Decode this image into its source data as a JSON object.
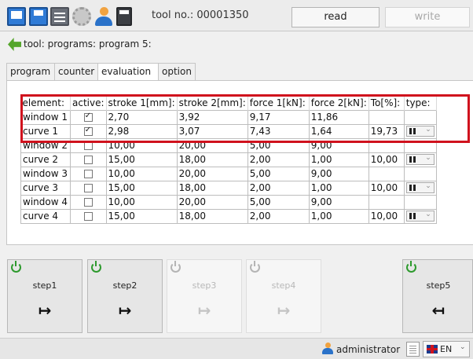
{
  "toolbar": {
    "icons": [
      "monitor-icon",
      "save-icon",
      "drawer-icon",
      "gear-icon",
      "user-icon",
      "calculator-icon"
    ],
    "tool_no": "tool no.: 00001350",
    "read_label": "read",
    "write_label": "write"
  },
  "breadcrumb": {
    "text": "tool: programs: program 5:"
  },
  "tabs": [
    {
      "label": "program"
    },
    {
      "label": "counter"
    },
    {
      "label": "evaluation",
      "active": true
    },
    {
      "label": "option"
    }
  ],
  "table": {
    "headers": [
      "element:",
      "active:",
      "stroke 1[mm]:",
      "stroke 2[mm]:",
      "force 1[kN]:",
      "force 2[kN]:",
      "To[%]:",
      "type:"
    ],
    "rows": [
      {
        "element": "window 1",
        "active": true,
        "s1": "2,70",
        "s2": "3,92",
        "f1": "9,17",
        "f2": "11,86",
        "to": "",
        "type": false
      },
      {
        "element": "curve 1",
        "active": true,
        "s1": "2,98",
        "s2": "3,07",
        "f1": "7,43",
        "f2": "1,64",
        "to": "19,73",
        "type": true
      },
      {
        "element": "window 2",
        "active": false,
        "s1": "10,00",
        "s2": "20,00",
        "f1": "5,00",
        "f2": "9,00",
        "to": "",
        "type": false
      },
      {
        "element": "curve 2",
        "active": false,
        "s1": "15,00",
        "s2": "18,00",
        "f1": "2,00",
        "f2": "1,00",
        "to": "10,00",
        "type": true
      },
      {
        "element": "window 3",
        "active": false,
        "s1": "10,00",
        "s2": "20,00",
        "f1": "5,00",
        "f2": "9,00",
        "to": "",
        "type": false
      },
      {
        "element": "curve 3",
        "active": false,
        "s1": "15,00",
        "s2": "18,00",
        "f1": "2,00",
        "f2": "1,00",
        "to": "10,00",
        "type": true
      },
      {
        "element": "window 4",
        "active": false,
        "s1": "10,00",
        "s2": "20,00",
        "f1": "5,00",
        "f2": "9,00",
        "to": "",
        "type": false
      },
      {
        "element": "curve 4",
        "active": false,
        "s1": "15,00",
        "s2": "18,00",
        "f1": "2,00",
        "f2": "1,00",
        "to": "10,00",
        "type": true
      }
    ],
    "highlight_color": "#d0121d"
  },
  "steps": [
    {
      "label": "step1",
      "enabled": true,
      "arrow": "→"
    },
    {
      "label": "step2",
      "enabled": true,
      "arrow": "→"
    },
    {
      "label": "step3",
      "enabled": false,
      "arrow": "→"
    },
    {
      "label": "step4",
      "enabled": false,
      "arrow": "→"
    },
    {
      "label": "step5",
      "enabled": true,
      "arrow": "←"
    }
  ],
  "status": {
    "user": "administrator",
    "language": "EN"
  }
}
